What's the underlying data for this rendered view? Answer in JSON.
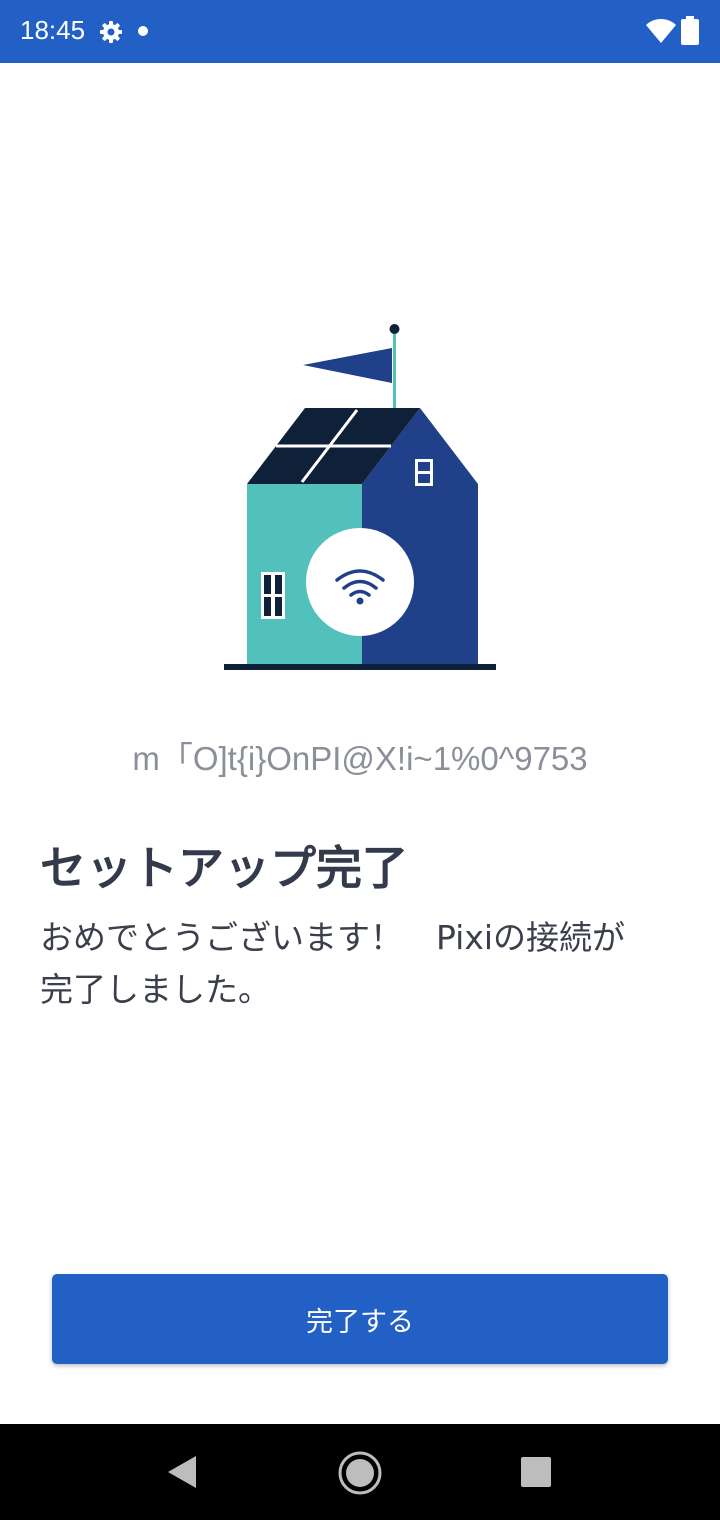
{
  "status_bar": {
    "time": "18:45",
    "icons": [
      "gear-icon",
      "notification-dot-icon",
      "wifi-icon",
      "battery-icon"
    ],
    "background_color": "#2260c6"
  },
  "illustration": {
    "subject": "house-with-wifi-illustration",
    "colors": {
      "wall_left": "#52c1bb",
      "wall_right": "#21408a",
      "roof": "#0f2039",
      "ground": "#0f2039"
    }
  },
  "device_id": "m「O]t{i}OnPI@X!i~1%0^9753",
  "title": "セットアップ完了",
  "message": {
    "line1": "おめでとうございます！　Pixiの接続が",
    "line2": "完了しました。"
  },
  "done_button": {
    "label": "完了する",
    "color": "#2260c6"
  },
  "nav_bar": {
    "icons": [
      "back-icon",
      "home-icon",
      "recents-icon"
    ]
  }
}
